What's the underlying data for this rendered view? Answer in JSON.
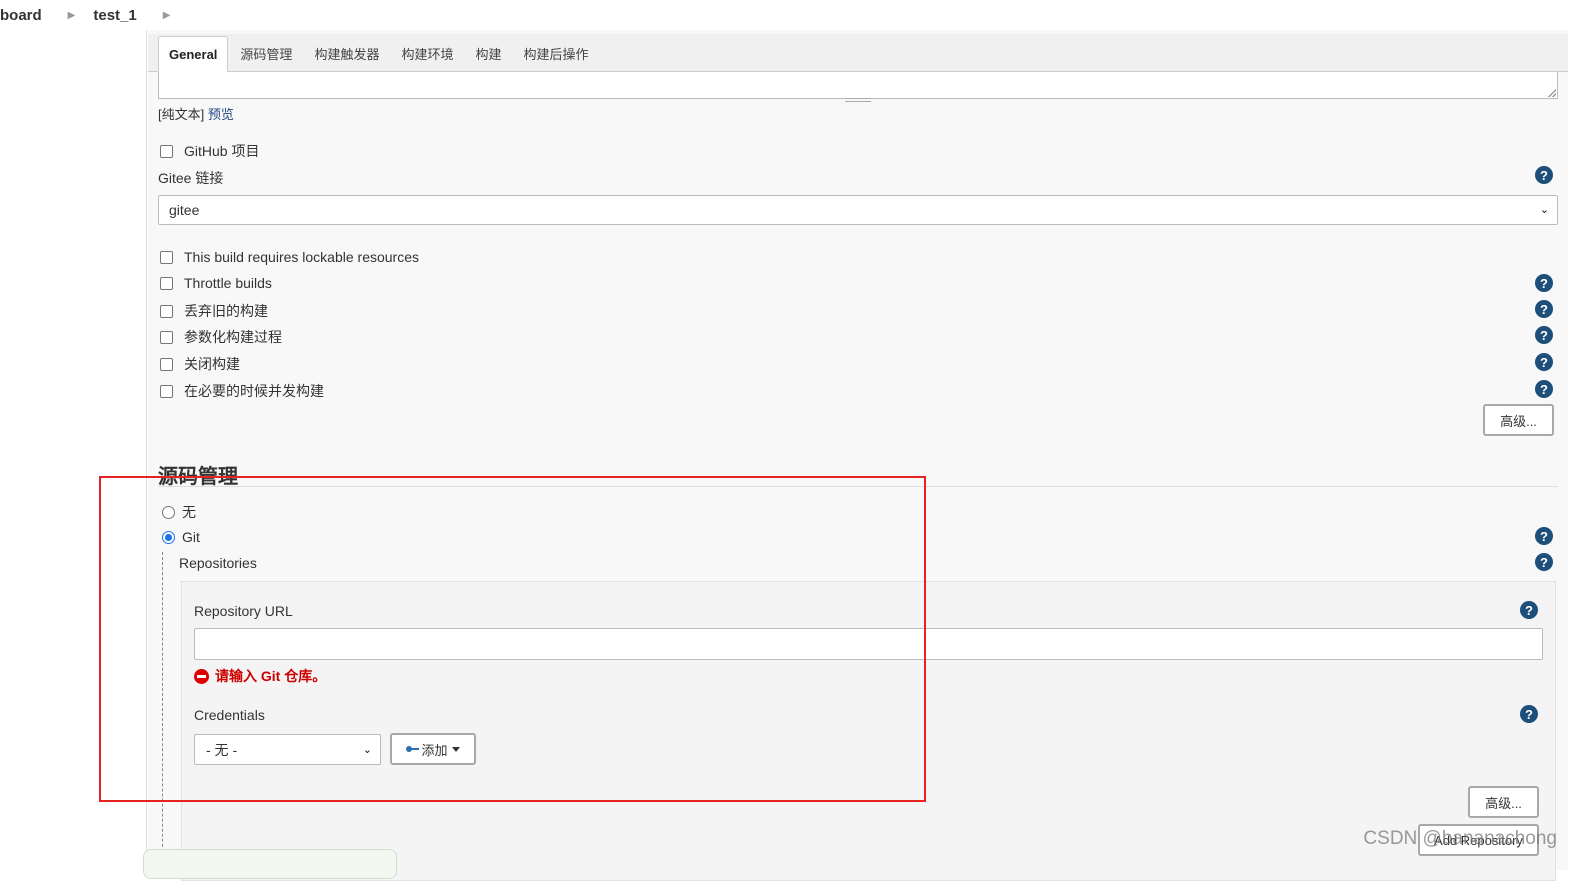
{
  "breadcrumb": {
    "items": [
      "board",
      "test_1"
    ]
  },
  "tabs": [
    "General",
    "源码管理",
    "构建触发器",
    "构建环境",
    "构建",
    "构建后操作"
  ],
  "description": {
    "plain_text": "[纯文本]",
    "preview": "预览"
  },
  "github_project_label": "GitHub 项目",
  "gitee": {
    "label": "Gitee 链接",
    "selected": "gitee"
  },
  "options": [
    "This build requires lockable resources",
    "Throttle builds",
    "丢弃旧的构建",
    "参数化构建过程",
    "关闭构建",
    "在必要的时候并发构建"
  ],
  "advanced_label": "高级...",
  "scm": {
    "title": "源码管理",
    "none_label": "无",
    "git_label": "Git",
    "repositories_label": "Repositories",
    "repo_url_label": "Repository URL",
    "repo_url_value": "",
    "error": "请输入 Git 仓库。",
    "credentials_label": "Credentials",
    "credentials_selected": "- 无 -",
    "add_label": "添加",
    "advanced_label": "高级...",
    "add_repository_label": "Add Repository"
  },
  "watermark": "CSDN @bananachong",
  "colors": {
    "highlight_box": "#e62222",
    "help_icon": "#1d4f7a",
    "error": "#cc0000"
  }
}
